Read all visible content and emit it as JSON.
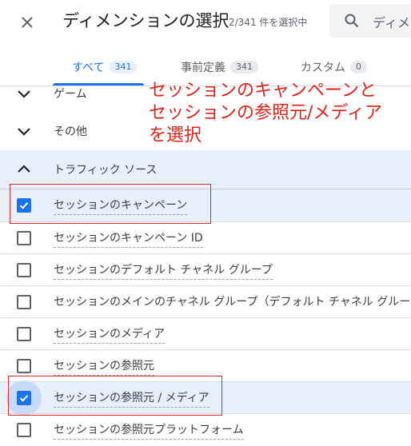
{
  "header": {
    "close_icon": "close-icon",
    "title": "ディメンションの選択",
    "selection_count": "2/341 件を選択中",
    "search_icon": "search-icon",
    "search_placeholder": "ディメン"
  },
  "tabs": [
    {
      "label": "すべて",
      "count": "341",
      "active": true
    },
    {
      "label": "事前定義",
      "count": "341",
      "active": false
    },
    {
      "label": "カスタム",
      "count": "0",
      "active": false
    }
  ],
  "groups": [
    {
      "label": "ゲーム",
      "expanded": false
    },
    {
      "label": "その他",
      "expanded": false
    },
    {
      "label": "トラフィック ソース",
      "expanded": true
    }
  ],
  "items": [
    {
      "label": "セッションのキャンペーン",
      "checked": true
    },
    {
      "label": "セッションのキャンペーン ID",
      "checked": false
    },
    {
      "label": "セッションのデフォルト チャネル グループ",
      "checked": false
    },
    {
      "label": "セッションのメインのチャネル グループ（デフォルト チャネル グルー",
      "checked": false
    },
    {
      "label": "セッションのメディア",
      "checked": false
    },
    {
      "label": "セッションの参照元",
      "checked": false
    },
    {
      "label": "セッションの参照元 / メディア",
      "checked": true
    },
    {
      "label": "セッションの参照元プラットフォーム",
      "checked": false
    }
  ],
  "annotation": "セッションのキャンペーンと\nセッションの参照元/メディア\nを選択",
  "colors": {
    "accent": "#1a73e8",
    "selected_row": "#e8f0fe",
    "annotation_red": "#e1231a"
  }
}
